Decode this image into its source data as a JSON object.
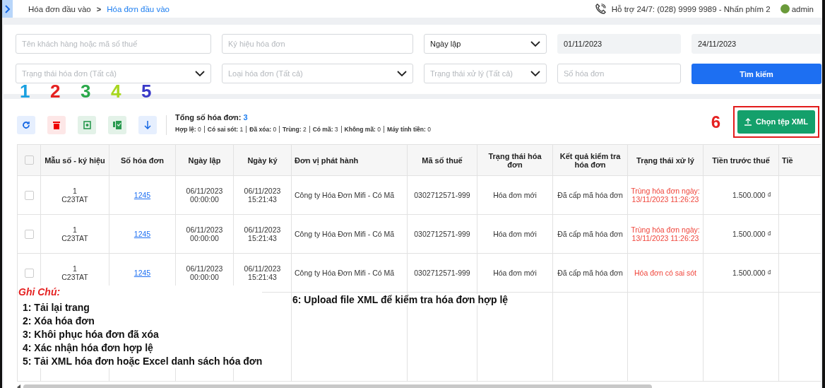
{
  "breadcrumb": {
    "parent": "Hóa đơn đầu vào",
    "separator": ">",
    "current": "Hóa đơn đầu vào"
  },
  "support": {
    "text": "Hỗ trợ 24/7: (028) 9999 9989 - Nhấn phím 2"
  },
  "user": {
    "name": "admin"
  },
  "filters": [
    {
      "kind": "input",
      "placeholder": "Tên khách hàng hoặc mã số thuế"
    },
    {
      "kind": "input",
      "placeholder": "Ký hiệu hóa đơn"
    },
    {
      "kind": "select",
      "value": "Ngày lập"
    },
    {
      "kind": "date",
      "value": "01/11/2023"
    },
    {
      "kind": "date",
      "value": "24/11/2023"
    },
    {
      "kind": "select",
      "placeholder": "Trạng thái hóa đơn (Tất cả)"
    },
    {
      "kind": "select",
      "placeholder": "Loại hóa đơn (Tất cả)"
    },
    {
      "kind": "select",
      "placeholder": "Trạng thái xử lý (Tất cả)"
    },
    {
      "kind": "input",
      "placeholder": "Số hóa đơn"
    },
    {
      "kind": "button",
      "label": "Tìm kiếm"
    }
  ],
  "toolbar": [
    {
      "kind": "reload",
      "annotation": "1",
      "color": "#1aa0e0"
    },
    {
      "kind": "delete",
      "annotation": "2",
      "color": "#e52222"
    },
    {
      "kind": "restore",
      "annotation": "3",
      "color": "#2aa84a"
    },
    {
      "kind": "confirm",
      "annotation": "4",
      "color": "#a8d620"
    },
    {
      "kind": "download",
      "annotation": "5",
      "color": "#3a3ac8"
    }
  ],
  "summary": {
    "label": "Tổng số hóa đơn:",
    "value": "3",
    "stats": [
      "**Hợp lệ:** 0",
      "**Có sai sót:** 1",
      "**Đã xóa:** 0",
      "**Trùng:** 2",
      "**Có mã:** 3",
      "**Không mã:** 0",
      "**Máy tính tiền:** 0"
    ]
  },
  "upload_button": {
    "label": "Chọn tệp XML",
    "annotation": "6"
  },
  "table": {
    "header_checked": false,
    "columns": [
      "Mẫu số - ký hiệu",
      "Số hóa đơn",
      "Ngày lập",
      "Ngày ký",
      "Đơn vị phát hành",
      "Mã số thuế",
      "Trạng thái hóa đơn",
      "Kết quả kiểm tra hóa đơn",
      "Trạng thái xử lý",
      "Tiền trước thuế",
      "Tiề"
    ],
    "rows": [
      {
        "checked": false,
        "cells": [
          "1\nC23TAT",
          "1245",
          "06/11/2023\n00:00:00",
          "06/11/2023\n15:21:43",
          "Công ty Hóa Đơn Mifi - Có Mã",
          "0302712571-999",
          "Hóa đơn mới",
          "Đã cấp mã hóa đơn",
          "Trùng hóa đơn ngày: 13/11/2023 11:26:23",
          "1.500.000 ₫"
        ]
      },
      {
        "checked": false,
        "cells": [
          "1\nC23TAT",
          "1245",
          "06/11/2023\n00:00:00",
          "06/11/2023\n15:21:43",
          "Công ty Hóa Đơn Mifi - Có Mã",
          "0302712571-999",
          "Hóa đơn mới",
          "Đã cấp mã hóa đơn",
          "Trùng hóa đơn ngày: 13/11/2023 11:26:23",
          "1.500.000 ₫"
        ]
      },
      {
        "checked": false,
        "cells": [
          "1\nC23TAT",
          "1245",
          "06/11/2023\n00:00:00",
          "06/11/2023\n15:21:43",
          "Công ty Hóa Đơn Mifi - Có Mã",
          "0302712571-999",
          "Hóa đơn mới",
          "Đã cấp mã hóa đơn",
          "Hóa đơn có sai sót",
          "1.500.000 ₫"
        ]
      }
    ]
  },
  "notes": {
    "title": "Ghi Chú:",
    "items": [
      "1: Tải lại trang",
      "2: Xóa hóa đơn",
      "3: Khôi phục hóa đơn đã xóa",
      "4: Xác nhận hóa đơn hợp lệ",
      "5: Tải XML hóa đơn hoặc Excel danh sách hóa đơn"
    ],
    "side_note": "6: Upload file XML để kiểm tra hóa đơn hợp lệ"
  }
}
